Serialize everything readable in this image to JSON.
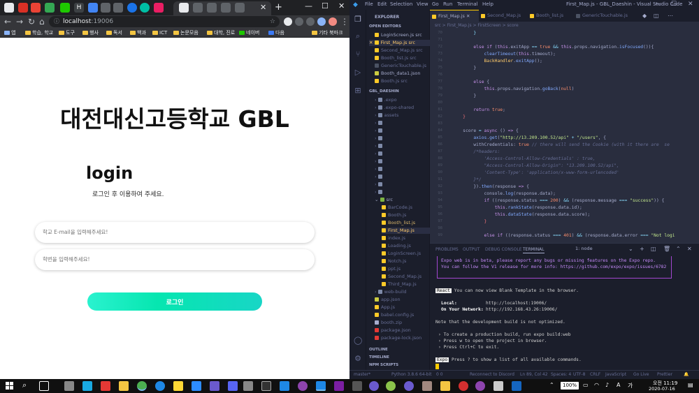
{
  "browser": {
    "url": "localhost",
    "port": ":19006",
    "bookmarks": [
      "앱",
      "학습, 학교",
      "도구",
      "행사",
      "독서",
      "백과",
      "ICT",
      "논문모음",
      "대학, 진로",
      "네이버",
      "다음",
      "기타 북마크"
    ]
  },
  "page": {
    "title": "대전대신고등학교 GBL",
    "login_heading": "login",
    "login_subtitle": "로그인 후 이용하여 주세요.",
    "email_placeholder": "학교 E-mail을 입력해주세요!",
    "student_id_placeholder": "학번을 입력해주세요!",
    "login_button": "로그인"
  },
  "vscode": {
    "menu": [
      "File",
      "Edit",
      "Selection",
      "View",
      "Go",
      "Run",
      "Terminal",
      "Help"
    ],
    "window_title": "First_Map.js - GBL_Daeshin - Visual Studio Code",
    "sidebar": {
      "explorer_label": "EXPLORER",
      "open_editors_label": "OPEN EDITORS",
      "open_editors": [
        "LoginScreen.js src",
        "First_Map.js src",
        "Second_Map.js src",
        "Booth_list.js src",
        "GenericTouchable.js",
        "Booth_data1.json",
        "Booth.js src"
      ],
      "project_label": "GBL_DAESHIN",
      "folders": [
        ".expo",
        ".expo-shared",
        "assets",
        "src"
      ],
      "src_files": [
        "BarCode.js",
        "Booth.js",
        "Booth_list.js",
        "First_Map.js",
        "index.js",
        "Loading.js",
        "LoginScreen.js",
        "Notch.js",
        "ppt.js",
        "Second_Map.js",
        "Third_Map.js"
      ],
      "root_files": [
        "web-build",
        "app.json",
        "App.js",
        "babel.config.js",
        "booth.zip",
        "package.json",
        "package-lock.json"
      ],
      "outline_label": "OUTLINE",
      "timeline_label": "TIMELINE",
      "npm_label": "NPM SCRIPTS"
    },
    "tabs": [
      "First_Map.js",
      "Second_Map.js",
      "Booth_list.js",
      "GenericTouchable.js"
    ],
    "breadcrumb": "src > First_Map.js > FirstScreen > score",
    "line_numbers": [
      "70",
      "71",
      "72",
      "73",
      "74",
      "75",
      "76",
      "77",
      "78",
      "79",
      "80",
      "81",
      "82",
      "83",
      "84",
      "85",
      "86",
      "87",
      "88",
      "89",
      "90",
      "91",
      "92",
      "93",
      "94",
      "95",
      "96",
      "97",
      "98",
      "99",
      "100",
      "101",
      "102",
      "103",
      "104",
      "105",
      "106"
    ],
    "panel_tabs": [
      "PROBLEMS",
      "OUTPUT",
      "DEBUG CONSOLE",
      "TERMINAL"
    ],
    "terminal_select": "1: node",
    "terminal": {
      "beta_line": "Expo web is in beta, please report any bugs or missing features on the Expo repo.",
      "release_line": "You can follow the V1 release for more info: https://github.com/expo/expo/issues/6782",
      "react_badge": "React",
      "view_line": "You can now view Blank Template in the browser.",
      "local_label": "Local:",
      "local_url": "http://localhost:19006/",
      "network_label": "On Your Network:",
      "network_url": "http://192.168.43.26:19006/",
      "dev_note": "Note that the development build is not optimized.",
      "hint1": "› To create a production build, run expo build:web",
      "hint2": "› Press w to open the project in browser.",
      "hint3": "› Press Ctrl+C to exit.",
      "expo_badge": "Expo",
      "expo_line": "Press ? to show a list of all available commands."
    },
    "status": {
      "branch": "master*",
      "python": "Python 3.8.6 64-bit",
      "errors": "0  0",
      "discord": "Reconnect to Discord",
      "position": "Ln 89, Col 42",
      "spaces": "Spaces: 4",
      "encoding": "UTF-8",
      "eol": "CRLF",
      "language": "JavaScript",
      "golive": "Go Live",
      "prettier": "Prettier"
    }
  },
  "taskbar": {
    "battery": "100%",
    "time": "오전 11:19",
    "date": "2020-07-16"
  }
}
